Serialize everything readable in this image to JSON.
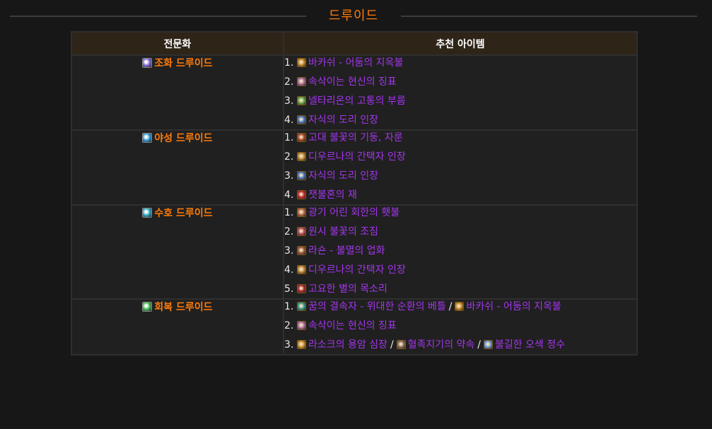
{
  "heading": "드루이드",
  "table": {
    "headers": {
      "spec": "전문화",
      "items": "추천 아이템"
    },
    "rows": [
      {
        "spec": "조화 드루이드",
        "spec_icon_color": "#8a6fd8",
        "items": [
          {
            "num": "1.",
            "entries": [
              {
                "label": "바카쉬 - 어둠의 지옥불",
                "icon": "gem-icon",
                "color": "#c58a2a"
              }
            ]
          },
          {
            "num": "2.",
            "entries": [
              {
                "label": "속삭이는 현신의 징표",
                "icon": "figure-icon",
                "color": "#b0709a"
              }
            ]
          },
          {
            "num": "3.",
            "entries": [
              {
                "label": "넬타리온의 고통의 부름",
                "icon": "scale-icon",
                "color": "#6aa548"
              }
            ]
          },
          {
            "num": "4.",
            "entries": [
              {
                "label": "자식의 도리 인장",
                "icon": "ring-icon",
                "color": "#4a76b8"
              }
            ]
          }
        ]
      },
      {
        "spec": "야성 드루이드",
        "spec_icon_color": "#3aa0d8",
        "items": [
          {
            "num": "1.",
            "entries": [
              {
                "label": "고대 불꽃의 기둥, 자룬",
                "icon": "claw-icon",
                "color": "#a84a2a"
              }
            ]
          },
          {
            "num": "2.",
            "entries": [
              {
                "label": "디우르나의 간택자 인장",
                "icon": "ring-icon",
                "color": "#c08a3a"
              }
            ]
          },
          {
            "num": "3.",
            "entries": [
              {
                "label": "자식의 도리 인장",
                "icon": "ring-icon",
                "color": "#4a76b8"
              }
            ]
          },
          {
            "num": "4.",
            "entries": [
              {
                "label": "잿불혼의 재",
                "icon": "ember-icon",
                "color": "#c02a2a"
              }
            ]
          }
        ]
      },
      {
        "spec": "수호 드루이드",
        "spec_icon_color": "#38b0c8",
        "items": [
          {
            "num": "1.",
            "entries": [
              {
                "label": "광기 어린 회한의 횃불",
                "icon": "torch-icon",
                "color": "#b86a4a"
              }
            ]
          },
          {
            "num": "2.",
            "entries": [
              {
                "label": "원시 불꽃의 조짐",
                "icon": "flame-icon",
                "color": "#b04a5a"
              }
            ]
          },
          {
            "num": "3.",
            "entries": [
              {
                "label": "라숀 - 불멸의 업화",
                "icon": "axe-icon",
                "color": "#9a5a3a"
              }
            ]
          },
          {
            "num": "4.",
            "entries": [
              {
                "label": "디우르나의 간택자 인장",
                "icon": "ring-icon",
                "color": "#c08a3a"
              }
            ]
          },
          {
            "num": "5.",
            "entries": [
              {
                "label": "고요한 별의 목소리",
                "icon": "star-icon",
                "color": "#a82a2a"
              }
            ]
          }
        ]
      },
      {
        "spec": "회복 드루이드",
        "spec_icon_color": "#4cc05a",
        "items": [
          {
            "num": "1.",
            "entries": [
              {
                "label": "꿈의 결속자 - 위대한 순환의 베틀",
                "icon": "loom-icon",
                "color": "#3a9a8a"
              },
              {
                "label": "바카쉬 - 어둠의 지옥불",
                "icon": "gem-icon",
                "color": "#c58a2a"
              }
            ]
          },
          {
            "num": "2.",
            "entries": [
              {
                "label": "속삭이는 현신의 징표",
                "icon": "figure-icon",
                "color": "#b0709a"
              }
            ]
          },
          {
            "num": "3.",
            "entries": [
              {
                "label": "라소크의 용암 심장",
                "icon": "heart-icon",
                "color": "#c8902a"
              },
              {
                "label": "혈족지기의 약속",
                "icon": "pouch-icon",
                "color": "#8a6a5a"
              },
              {
                "label": "불길한 오색 정수",
                "icon": "orb-icon",
                "color": "#6a9ad8"
              }
            ]
          }
        ]
      }
    ]
  }
}
